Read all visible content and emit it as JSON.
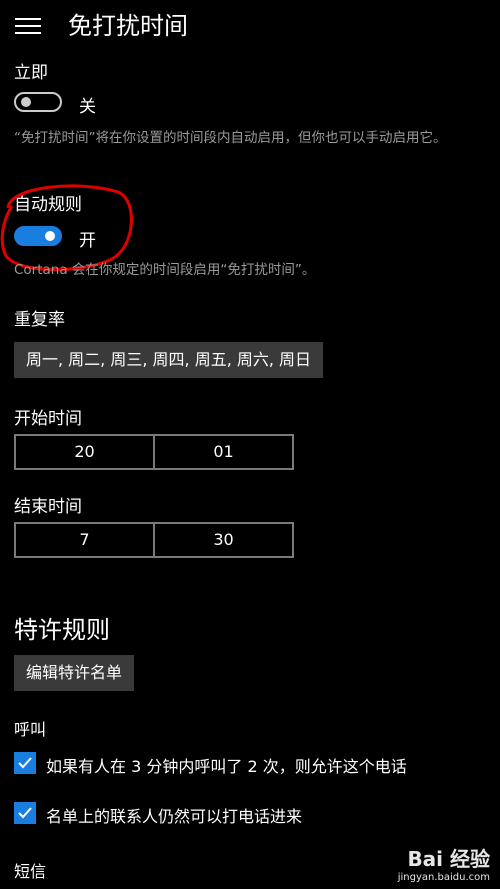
{
  "header": {
    "title": "免打扰时间"
  },
  "immediate": {
    "label": "立即",
    "toggle_state": "关",
    "description": "“免打扰时间”将在你设置的时间段内自动启用，但你也可以手动启用它。"
  },
  "auto_rule": {
    "label": "自动规则",
    "toggle_state": "开",
    "description": "Cortana 会在你规定的时间段启用“免打扰时间”。"
  },
  "repeat": {
    "label": "重复率",
    "value": "周一, 周二, 周三, 周四, 周五, 周六, 周日"
  },
  "start_time": {
    "label": "开始时间",
    "hour": "20",
    "minute": "01"
  },
  "end_time": {
    "label": "结束时间",
    "hour": "7",
    "minute": "30"
  },
  "exceptions": {
    "title": "特许规则",
    "edit_button": "编辑特许名单",
    "calls_label": "呼叫",
    "calls_option1": "如果有人在 3 分钟内呼叫了 2 次，则允许这个电话",
    "calls_option2": "名单上的联系人仍然可以打电话进来",
    "sms_label": "短信"
  },
  "watermark": {
    "text": "Bai 经验",
    "sub": "jingyan.baidu.com"
  },
  "colors": {
    "accent": "#1a7ee0",
    "annotation": "#e00000"
  }
}
